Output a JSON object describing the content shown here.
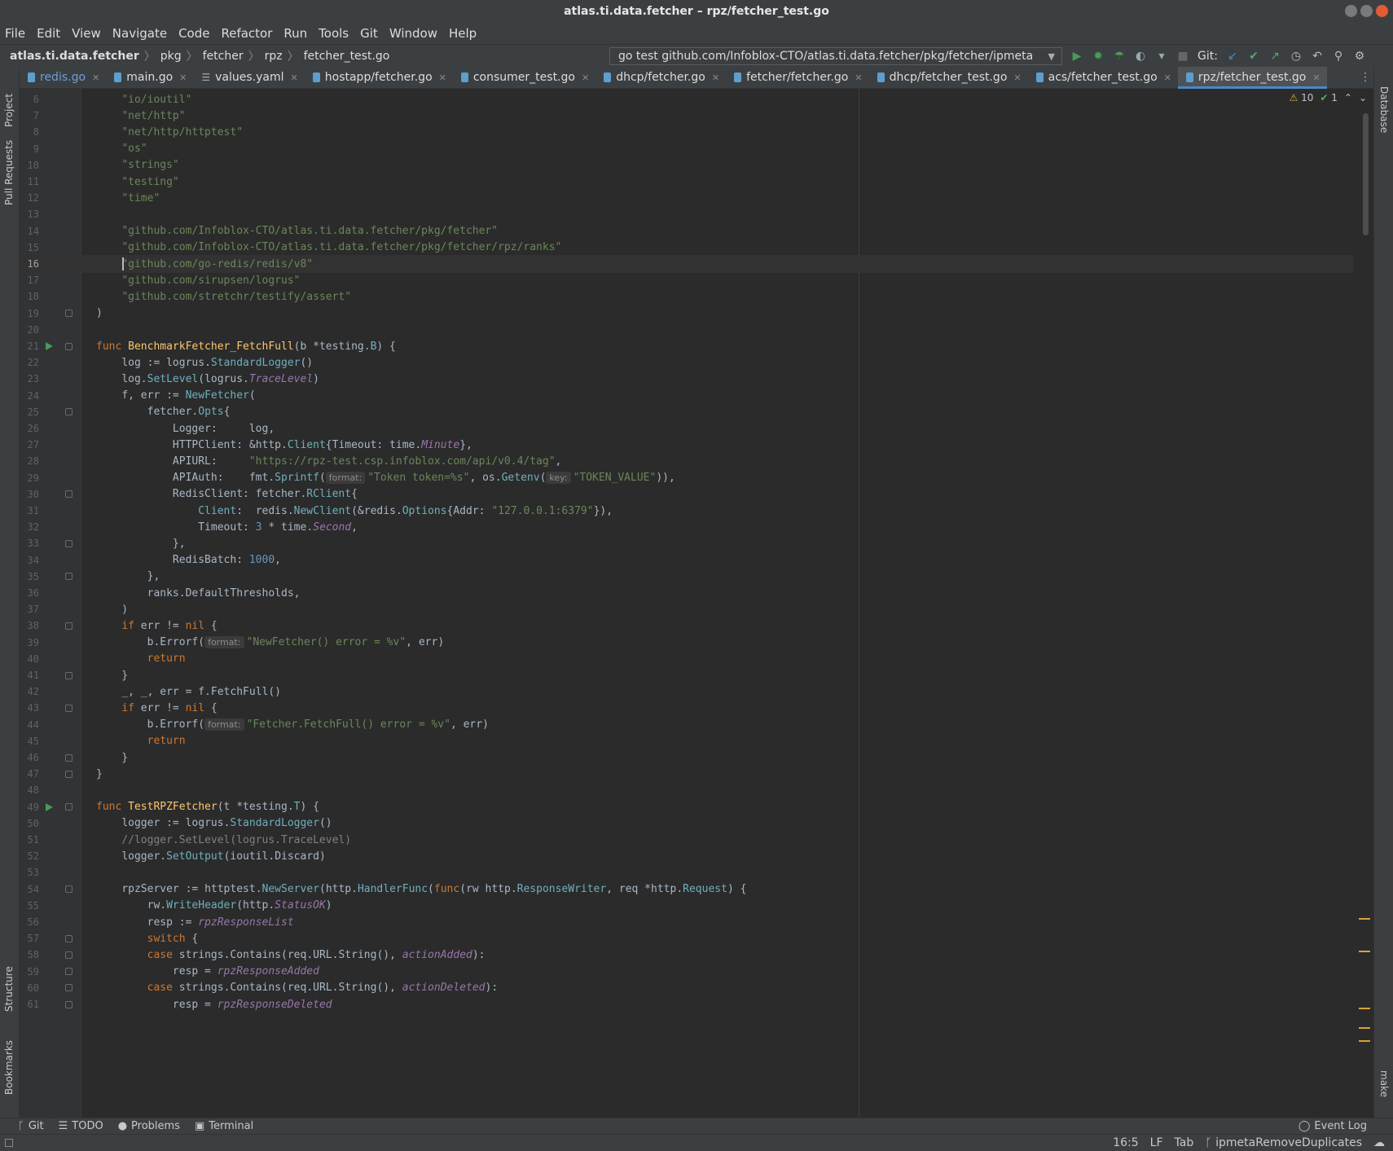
{
  "window": {
    "title": "atlas.ti.data.fetcher – rpz/fetcher_test.go"
  },
  "menu": [
    "File",
    "Edit",
    "View",
    "Navigate",
    "Code",
    "Refactor",
    "Run",
    "Tools",
    "Git",
    "Window",
    "Help"
  ],
  "breadcrumb": [
    "atlas.ti.data.fetcher",
    "pkg",
    "fetcher",
    "rpz",
    "fetcher_test.go"
  ],
  "run_config": "go test github.com/Infoblox-CTO/atlas.ti.data.fetcher/pkg/fetcher/ipmeta",
  "git_label": "Git:",
  "tabs": [
    {
      "label": "redis.go",
      "icon": "go-file-icon"
    },
    {
      "label": "main.go",
      "icon": "go-file-icon"
    },
    {
      "label": "values.yaml",
      "icon": "yaml-file-icon"
    },
    {
      "label": "hostapp/fetcher.go",
      "icon": "go-file-icon"
    },
    {
      "label": "consumer_test.go",
      "icon": "go-file-icon"
    },
    {
      "label": "dhcp/fetcher.go",
      "icon": "go-file-icon"
    },
    {
      "label": "fetcher/fetcher.go",
      "icon": "go-file-icon"
    },
    {
      "label": "dhcp/fetcher_test.go",
      "icon": "go-file-icon"
    },
    {
      "label": "acs/fetcher_test.go",
      "icon": "go-file-icon"
    },
    {
      "label": "rpz/fetcher_test.go",
      "icon": "go-file-icon",
      "active": true
    }
  ],
  "left_tools": [
    "Project",
    "Pull Requests",
    "Structure",
    "Bookmarks"
  ],
  "right_tools": [
    "Database",
    "make"
  ],
  "inspections": {
    "warnings": "10",
    "ok": "1"
  },
  "code_lines": [
    {
      "n": "6",
      "text": "    \"io/ioutil\""
    },
    {
      "n": "7",
      "text": "    \"net/http\""
    },
    {
      "n": "8",
      "text": "    \"net/http/httptest\""
    },
    {
      "n": "9",
      "text": "    \"os\""
    },
    {
      "n": "10",
      "text": "    \"strings\""
    },
    {
      "n": "11",
      "text": "    \"testing\""
    },
    {
      "n": "12",
      "text": "    \"time\""
    },
    {
      "n": "13",
      "text": ""
    },
    {
      "n": "14",
      "text": "    \"github.com/Infoblox-CTO/atlas.ti.data.fetcher/pkg/fetcher\""
    },
    {
      "n": "15",
      "text": "    \"github.com/Infoblox-CTO/atlas.ti.data.fetcher/pkg/fetcher/rpz/ranks\""
    },
    {
      "n": "16",
      "text": "    \"github.com/go-redis/redis/v8\""
    },
    {
      "n": "17",
      "text": "    \"github.com/sirupsen/logrus\""
    },
    {
      "n": "18",
      "text": "    \"github.com/stretchr/testify/assert\""
    },
    {
      "n": "19",
      "text": ")"
    },
    {
      "n": "20",
      "text": ""
    },
    {
      "n": "21",
      "text": "func BenchmarkFetcher_FetchFull(b *testing.B) {"
    },
    {
      "n": "22",
      "text": "    log := logrus.StandardLogger()"
    },
    {
      "n": "23",
      "text": "    log.SetLevel(logrus.TraceLevel)"
    },
    {
      "n": "24",
      "text": "    f, err := NewFetcher("
    },
    {
      "n": "25",
      "text": "        fetcher.Opts{"
    },
    {
      "n": "26",
      "text": "            Logger:     log,"
    },
    {
      "n": "27",
      "text": "            HTTPClient: &http.Client{Timeout: time.Minute},"
    },
    {
      "n": "28",
      "text": "            APIURL:     \"https://rpz-test.csp.infoblox.com/api/v0.4/tag\","
    },
    {
      "n": "29",
      "text": "            APIAuth:    fmt.Sprintf( format: \"Token token=%s\", os.Getenv( key: \"TOKEN_VALUE\")),"
    },
    {
      "n": "30",
      "text": "            RedisClient: fetcher.RClient{"
    },
    {
      "n": "31",
      "text": "                Client:  redis.NewClient(&redis.Options{Addr: \"127.0.0.1:6379\"}),"
    },
    {
      "n": "32",
      "text": "                Timeout: 3 * time.Second,"
    },
    {
      "n": "33",
      "text": "            },"
    },
    {
      "n": "34",
      "text": "            RedisBatch: 1000,"
    },
    {
      "n": "35",
      "text": "        },"
    },
    {
      "n": "36",
      "text": "        ranks.DefaultThresholds,"
    },
    {
      "n": "37",
      "text": "    )"
    },
    {
      "n": "38",
      "text": "    if err != nil {"
    },
    {
      "n": "39",
      "text": "        b.Errorf( format: \"NewFetcher() error = %v\", err)"
    },
    {
      "n": "40",
      "text": "        return"
    },
    {
      "n": "41",
      "text": "    }"
    },
    {
      "n": "42",
      "text": "    _, _, err = f.FetchFull()"
    },
    {
      "n": "43",
      "text": "    if err != nil {"
    },
    {
      "n": "44",
      "text": "        b.Errorf( format: \"Fetcher.FetchFull() error = %v\", err)"
    },
    {
      "n": "45",
      "text": "        return"
    },
    {
      "n": "46",
      "text": "    }"
    },
    {
      "n": "47",
      "text": "}"
    },
    {
      "n": "48",
      "text": ""
    },
    {
      "n": "49",
      "text": "func TestRPZFetcher(t *testing.T) {"
    },
    {
      "n": "50",
      "text": "    logger := logrus.StandardLogger()"
    },
    {
      "n": "51",
      "text": "    //logger.SetLevel(logrus.TraceLevel)"
    },
    {
      "n": "52",
      "text": "    logger.SetOutput(ioutil.Discard)"
    },
    {
      "n": "53",
      "text": ""
    },
    {
      "n": "54",
      "text": "    rpzServer := httptest.NewServer(http.HandlerFunc(func(rw http.ResponseWriter, req *http.Request) {"
    },
    {
      "n": "55",
      "text": "        rw.WriteHeader(http.StatusOK)"
    },
    {
      "n": "56",
      "text": "        resp := rpzResponseList"
    },
    {
      "n": "57",
      "text": "        switch {"
    },
    {
      "n": "58",
      "text": "        case strings.Contains(req.URL.String(), actionAdded):"
    },
    {
      "n": "59",
      "text": "            resp = rpzResponseAdded"
    },
    {
      "n": "60",
      "text": "        case strings.Contains(req.URL.String(), actionDeleted):"
    },
    {
      "n": "61",
      "text": "            resp = rpzResponseDeleted"
    }
  ],
  "bottom_tools": [
    "Git",
    "TODO",
    "Problems",
    "Terminal"
  ],
  "event_log": "Event Log",
  "status": {
    "position": "16:5",
    "line_sep": "LF",
    "indent": "Tab",
    "branch": "ipmetaRemoveDuplicates"
  },
  "colors": {
    "accent": "#4a88c7",
    "run_green": "#499c54",
    "warning": "#e2a93a",
    "close": "#e25b34"
  }
}
